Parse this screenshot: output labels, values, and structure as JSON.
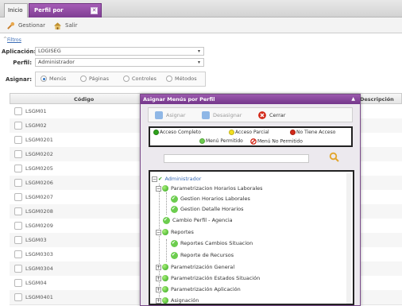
{
  "tabs": [
    {
      "label": "Inicio"
    },
    {
      "label": "Perfil por Aplicacion"
    }
  ],
  "toolbar": {
    "gestionar": "Gestionar",
    "salir": "Salir"
  },
  "filtros": {
    "label": "Filtros"
  },
  "form": {
    "aplicacion_label": "Aplicación:",
    "aplicacion_value": "LOGISEG",
    "perfil_label": "Perfil:",
    "perfil_value": "Administrador",
    "asignar_label": "Asignar:",
    "radios": [
      "Menús",
      "Páginas",
      "Controles",
      "Métodos"
    ],
    "selected_radio": "Menús"
  },
  "grid": {
    "col_codigo": "Código",
    "col_descripcion": "Descripción",
    "rows": [
      "LSGM01",
      "LSGM02",
      "LSGM0201",
      "LSGM0202",
      "LSGM0205",
      "LSGM0206",
      "LSGM0207",
      "LSGM0208",
      "LSGM0209",
      "LSGM03",
      "LSGM0303",
      "LSGM0304",
      "LSGM04",
      "LSGM0401"
    ]
  },
  "dialog": {
    "title": "Asignar Menús por Perfil",
    "asignar": "Asignar",
    "desasignar": "Desasignar",
    "cerrar": "Cerrar",
    "legend": {
      "completo": "Acceso Completo",
      "parcial": "Acceso Parcial",
      "no_tiene": "No Tiene Acceso",
      "permitido": "Menú Permitido",
      "no_permitido": "Menú No Permitido"
    },
    "tree": {
      "root": "Administrador",
      "n1": "Parametrizacion Horarios Laborales",
      "n1a": "Gestion Horarios Laborales",
      "n1b": "Gestion Detalle Horarios",
      "n2": "Cambio Perfil - Agencia",
      "n3": "Reportes",
      "n3a": "Reportes Cambios Situacion",
      "n3b": "Reporte de Recursos",
      "n4": "Parametrización General",
      "n5": "Parametrización Estados Situación",
      "n6": "Parametrización Aplicación",
      "n7": "Asignación"
    }
  },
  "colors": {
    "accent": "#7f3d93",
    "green": "#2ea21b",
    "yellow": "#f3e020",
    "red": "#d32a1a"
  }
}
